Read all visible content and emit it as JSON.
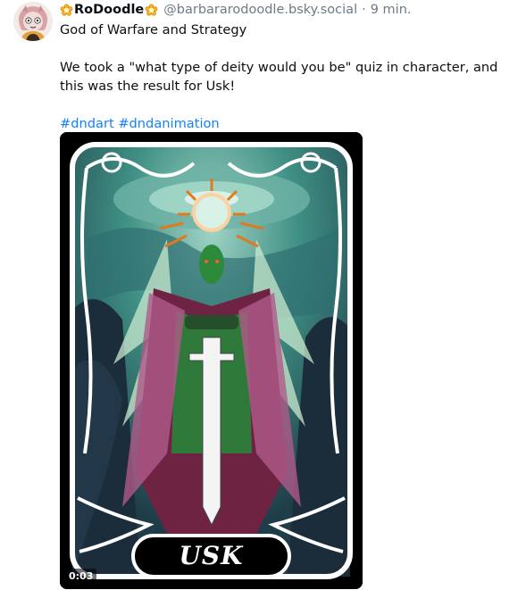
{
  "post": {
    "display_name": "RoDoodle",
    "handle": "@barbararodoodle.bsky.social",
    "separator": "·",
    "time": "9 min.",
    "paragraph1": "God of Warfare and Strategy",
    "paragraph2": "We took a \"what type of deity would you be\" quiz in character, and this was the result for Usk!",
    "hashtags": [
      "#dndart",
      "#dndanimation"
    ]
  },
  "media": {
    "card_title": "USK",
    "video_time": "0:03"
  },
  "colors": {
    "link": "#1083fe",
    "muted": "#6e7a88",
    "badge": "#f5b321"
  },
  "icons": {
    "left_badge": "flower-badge-icon",
    "right_badge": "flower-badge-icon"
  }
}
